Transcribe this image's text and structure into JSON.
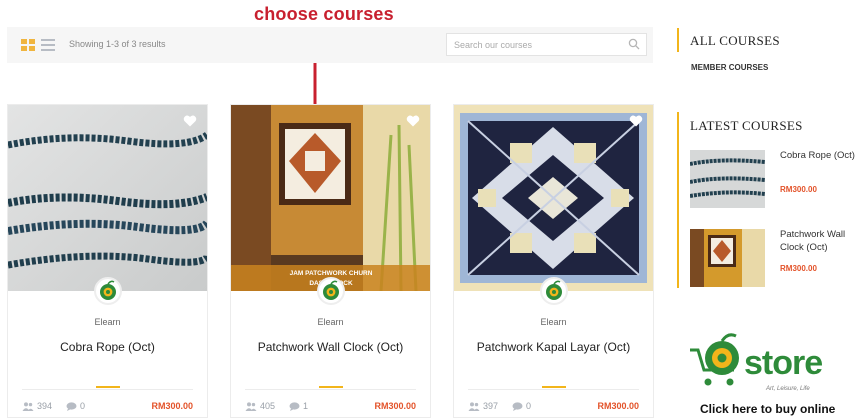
{
  "annotation": {
    "text": "choose courses"
  },
  "toolbar": {
    "showing_text": "Showing 1-3 of 3 results",
    "search_placeholder": "Search our courses"
  },
  "courses": [
    {
      "author": "Elearn",
      "title": "Cobra Rope (Oct)",
      "students": "394",
      "comments": "0",
      "price": "RM300.00"
    },
    {
      "author": "Elearn",
      "title": "Patchwork Wall Clock (Oct)",
      "students": "405",
      "comments": "1",
      "price": "RM300.00",
      "image_caption": "JAM PATCHWORK CHURN DASH CLOCK"
    },
    {
      "author": "Elearn",
      "title": "Patchwork Kapal Layar (Oct)",
      "students": "397",
      "comments": "0",
      "price": "RM300.00"
    }
  ],
  "sidebar": {
    "all_courses_heading": "ALL COURSES",
    "member_courses_link": "MEMBER COURSES",
    "latest_heading": "LATEST COURSES",
    "latest": [
      {
        "title": "Cobra Rope (Oct)",
        "price": "RM300.00"
      },
      {
        "title": "Patchwork Wall Clock (Oct)",
        "price": "RM300.00"
      }
    ]
  },
  "estore": {
    "logo_text": "store",
    "tagline": "Art, Leisure, Life",
    "cta": "Click here to buy online"
  },
  "colors": {
    "accent": "#f2b51b",
    "price": "#e3532a",
    "annotation": "#c8202f",
    "brand_green": "#2e8b3a"
  }
}
